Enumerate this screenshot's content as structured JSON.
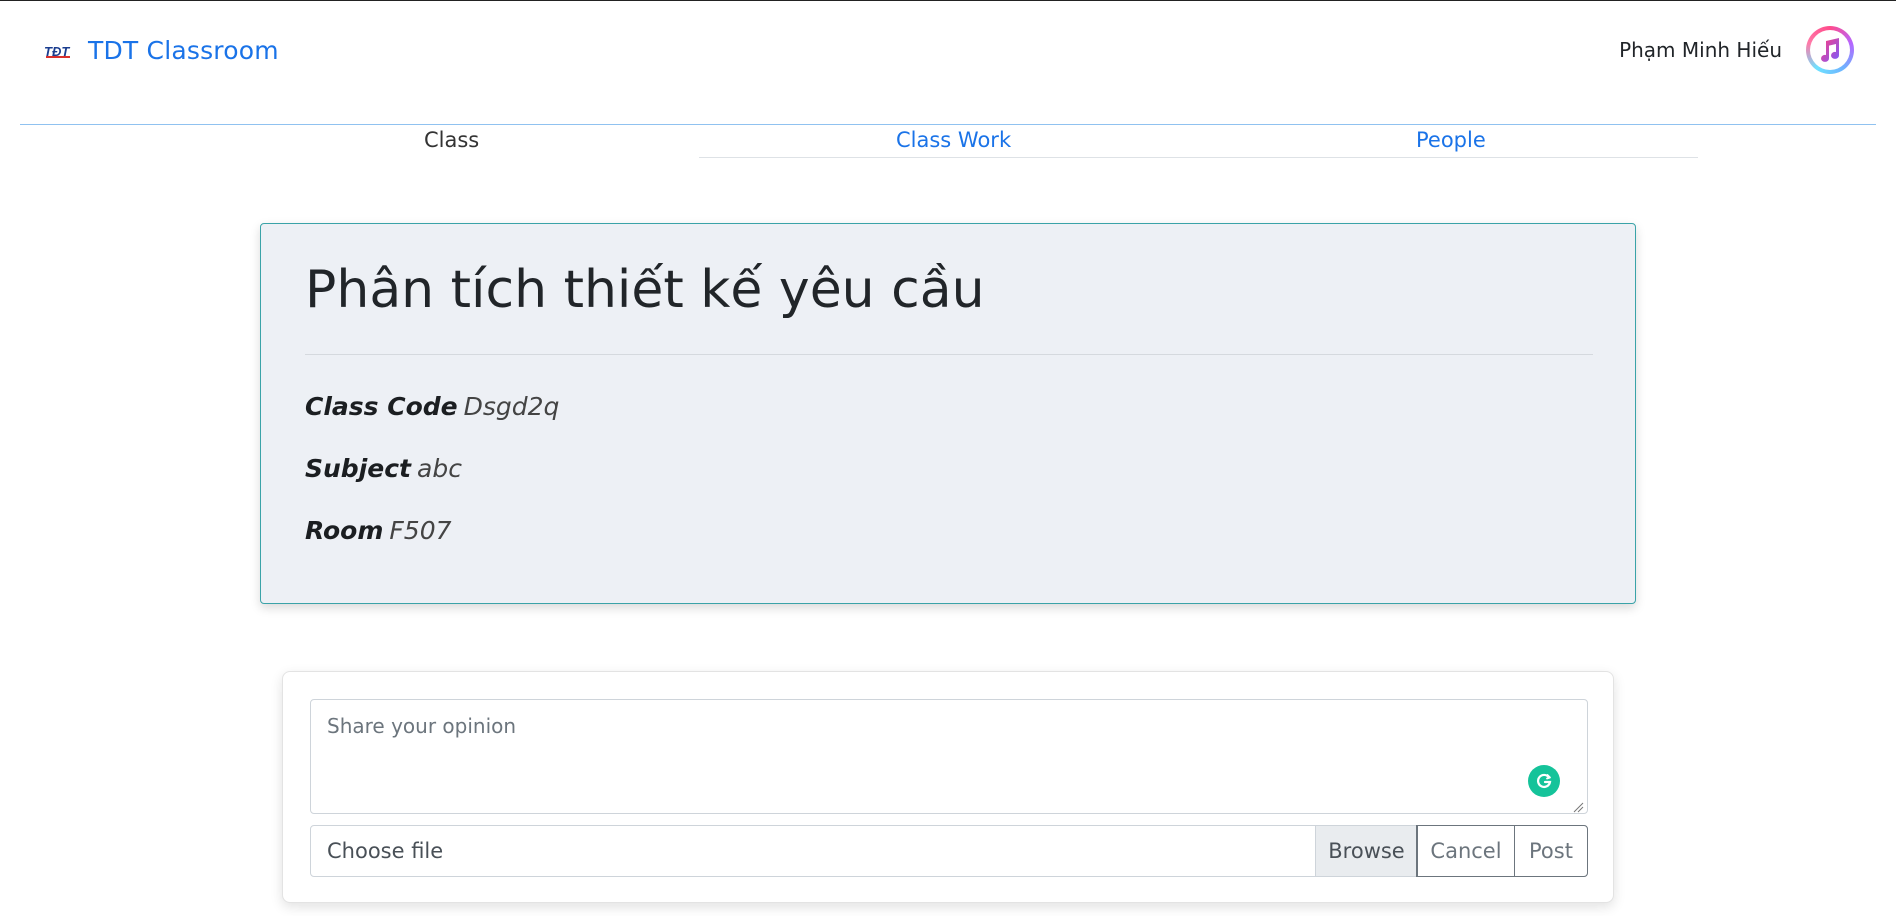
{
  "header": {
    "brand_name": "TDT Classroom",
    "logo_icon": "tdt-logo-icon",
    "user_name": "Phạm Minh Hiếu",
    "avatar_icon": "music-note-icon",
    "brand_color": "#1a73e8"
  },
  "nav": {
    "tabs": [
      {
        "label": "Class",
        "active": true
      },
      {
        "label": "Class Work",
        "active": false
      },
      {
        "label": "People",
        "active": false
      }
    ]
  },
  "class_info": {
    "title": "Phân tích thiết kế yêu cầu",
    "fields": [
      {
        "label": "Class Code",
        "value": "Dsgd2q"
      },
      {
        "label": "Subject",
        "value": "abc"
      },
      {
        "label": "Room",
        "value": "F507"
      }
    ],
    "background_color": "#edf0f5",
    "border_color": "#3aa3a8"
  },
  "post": {
    "placeholder": "Share your opinion",
    "file_label": "Choose file",
    "browse_label": "Browse",
    "cancel_label": "Cancel",
    "post_label": "Post",
    "assistant_icon": "grammarly-icon",
    "assistant_color": "#15c39a"
  }
}
